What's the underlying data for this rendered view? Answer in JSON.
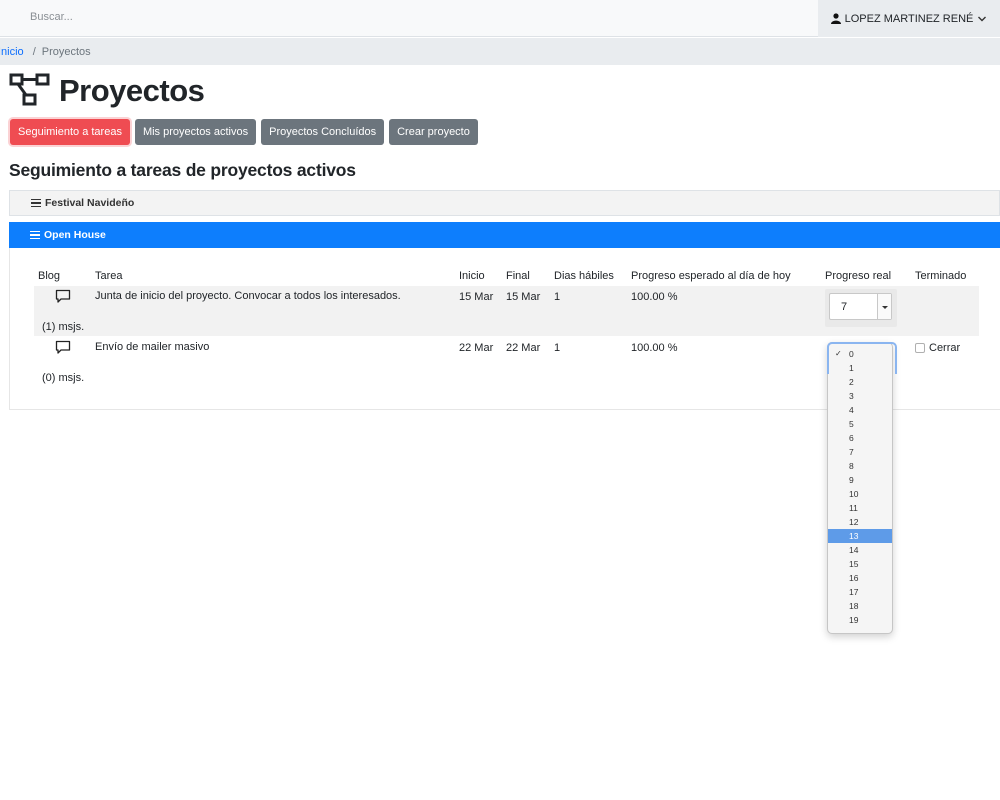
{
  "header": {
    "search_placeholder": "Buscar...",
    "user_name": "LOPEZ MARTINEZ RENÉ"
  },
  "breadcrumb": {
    "home": "Inicio",
    "current": "Proyectos"
  },
  "page": {
    "title": "Proyectos",
    "section_heading": "Seguimiento a tareas de proyectos activos"
  },
  "tabs": [
    {
      "label": "Seguimiento a tareas",
      "active": true
    },
    {
      "label": "Mis proyectos activos",
      "active": false
    },
    {
      "label": "Proyectos Concluídos",
      "active": false
    },
    {
      "label": "Crear proyecto",
      "active": false
    }
  ],
  "projects": [
    {
      "name": "Festival Navideño",
      "expanded": false
    },
    {
      "name": "Open House",
      "expanded": true
    }
  ],
  "table": {
    "columns": [
      "Blog",
      "Tarea",
      "Inicio",
      "Final",
      "Dias hábiles",
      "Progreso esperado al día de hoy",
      "Progreso real",
      "Terminado"
    ],
    "rows": [
      {
        "messages": "(1) msjs.",
        "task": "Junta de inicio del proyecto. Convocar a todos los interesados.",
        "start": "15 Mar",
        "end": "15 Mar",
        "workdays": "1",
        "expected": "100.00 %",
        "real": "7",
        "done_label": ""
      },
      {
        "messages": "(0) msjs.",
        "task": "Envío de mailer masivo",
        "start": "22 Mar",
        "end": "22 Mar",
        "workdays": "1",
        "expected": "100.00 %",
        "real": "0",
        "done_label": "Cerrar"
      }
    ]
  },
  "dropdown": {
    "options": [
      "0",
      "1",
      "2",
      "3",
      "4",
      "5",
      "6",
      "7",
      "8",
      "9",
      "10",
      "11",
      "12",
      "13",
      "14",
      "15",
      "16",
      "17",
      "18",
      "19"
    ],
    "selected": "0",
    "highlighted": "13"
  },
  "colors": {
    "accent_active_tab": "#ef4c52",
    "secondary_button": "#6c757d",
    "expanded_project": "#0d7efd",
    "link": "#0d6efd"
  }
}
